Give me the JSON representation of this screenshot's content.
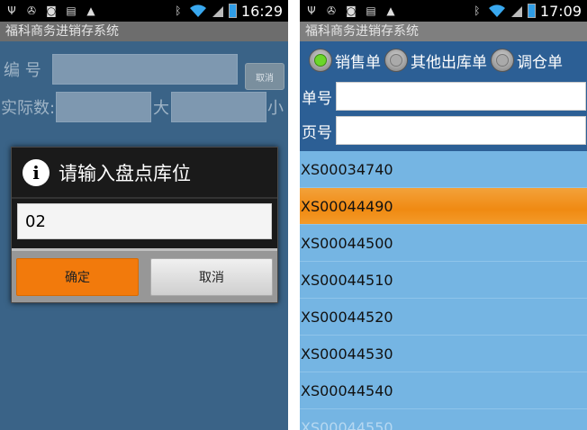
{
  "left": {
    "status": {
      "time": "16:29"
    },
    "app_title": "福科商务进销存系统",
    "form": {
      "code_label": "编  号",
      "cancel_small": "取消",
      "actual_label": "实际数:",
      "big_label": "大",
      "small_label": "小"
    },
    "dialog": {
      "title": "请输入盘点库位",
      "input_value": "02",
      "ok_label": "确定",
      "cancel_label": "取消"
    }
  },
  "right": {
    "status": {
      "time": "17:09"
    },
    "app_title": "福科商务进销存系统",
    "radios": [
      {
        "label": "销售单",
        "selected": true
      },
      {
        "label": "其他出库单",
        "selected": false
      },
      {
        "label": "调仓单",
        "selected": false
      }
    ],
    "fields": {
      "order_no_label": "单号",
      "page_no_label": "页号"
    },
    "list": [
      "XS00034740",
      "XS00044490",
      "XS00044500",
      "XS00044510",
      "XS00044520",
      "XS00044530",
      "XS00044540",
      "XS00044550"
    ],
    "selected_index": 1
  },
  "colors": {
    "accent": "#f27a0c",
    "list_bg": "#75b5e3",
    "radio_on": "#6bd62a"
  }
}
